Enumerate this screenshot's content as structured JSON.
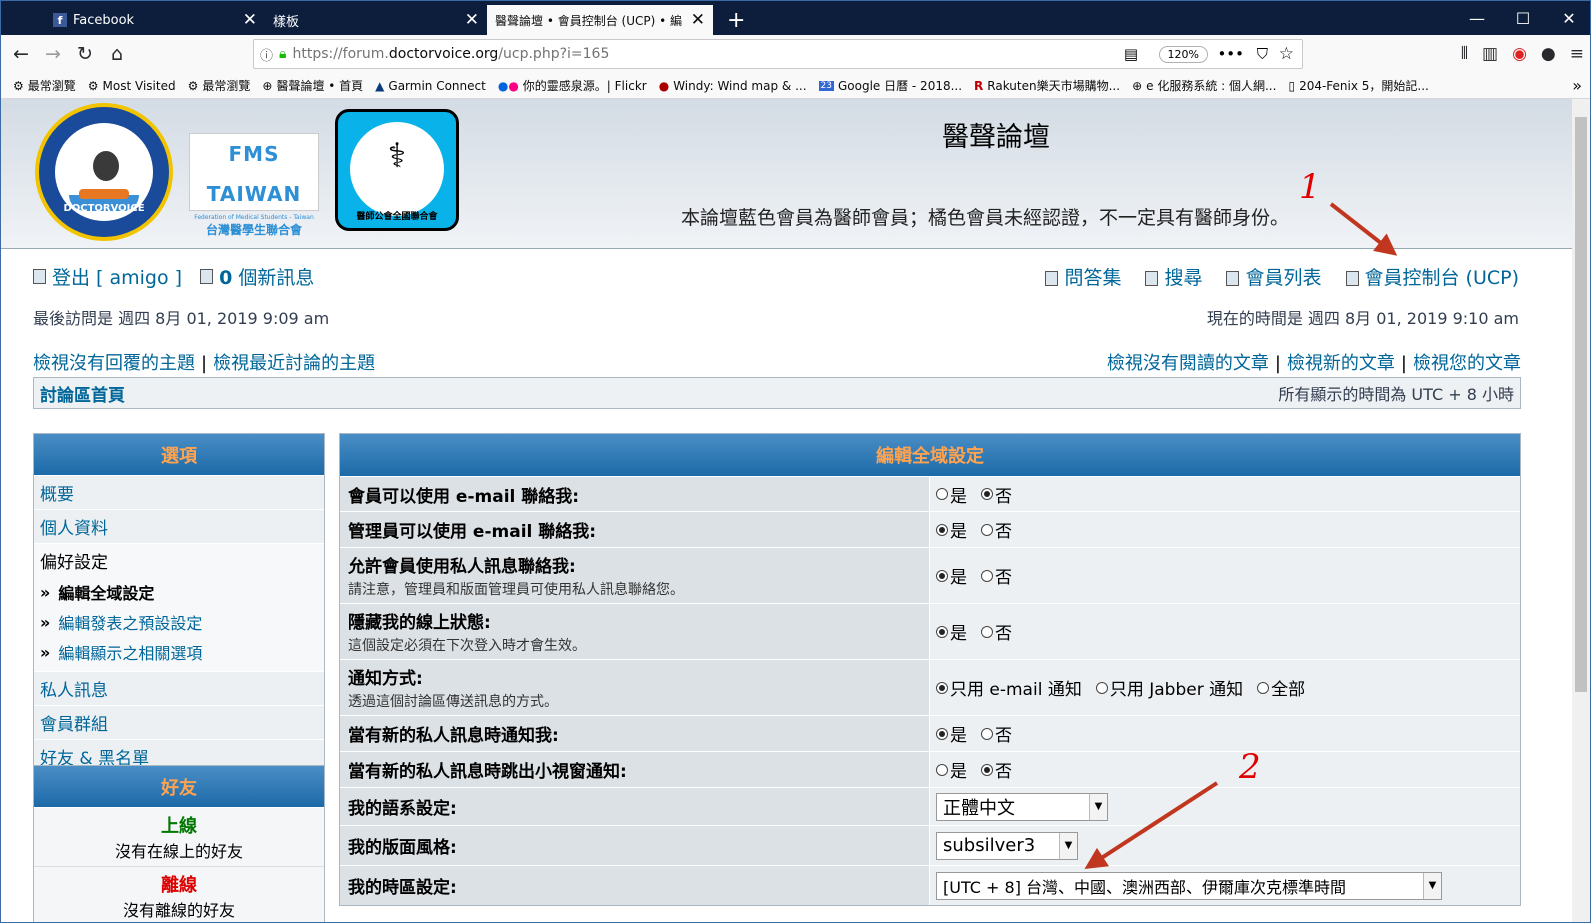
{
  "browser": {
    "tabs": [
      {
        "label": "Facebook"
      },
      {
        "label": "樣板"
      },
      {
        "label": "醫聲論壇 • 會員控制台 (UCP) • 編"
      }
    ],
    "url": {
      "prefix": "https://forum.",
      "host": "doctorvoice.org",
      "path": "/ucp.php?i=165"
    },
    "zoom": "120%",
    "bookmarks": [
      {
        "label": "最常瀏覽",
        "icon": "gear-icon"
      },
      {
        "label": "Most Visited",
        "icon": "gear-icon"
      },
      {
        "label": "最常瀏覽",
        "icon": "gear-icon"
      },
      {
        "label": "醫聲論壇 • 首頁",
        "icon": "globe-icon"
      },
      {
        "label": "Garmin Connect",
        "icon": "garmin-icon"
      },
      {
        "label": "你的靈感泉源。| Flickr",
        "icon": "flickr-icon"
      },
      {
        "label": "Windy: Wind map & ...",
        "icon": "windy-icon"
      },
      {
        "label": "Google 日曆 - 2018...",
        "icon": "calendar-icon"
      },
      {
        "label": "Rakuten樂天市場購物...",
        "icon": "rakuten-icon"
      },
      {
        "label": "e 化服務系統 : 個人網...",
        "icon": "globe-icon"
      },
      {
        "label": "204-Fenix 5，開始記...",
        "icon": "doc-icon"
      }
    ]
  },
  "site": {
    "title": "醫聲論壇",
    "description": "本論壇藍色會員為醫師會員；橘色會員未經認證，不一定具有醫師身份。",
    "logo1_text": "DOCTORVOICE",
    "logo2_main": "FMS TAIWAN",
    "logo2_sub": "Federation of Medical Students - Taiwan",
    "logo2_zh": "台灣醫學生聯合會",
    "logo3_zh": "醫師公會全國聯合會"
  },
  "annotations": {
    "one": "1",
    "two": "2"
  },
  "user": {
    "logout": "登出 [ amigo ]",
    "new_msgs_count": "0",
    "new_msgs_label": "個新訊息",
    "last_visit": "最後訪問是 週四 8月 01, 2019 9:09 am",
    "now": "現在的時間是 週四 8月 01, 2019 9:10 am"
  },
  "toplinks": {
    "faq": "問答集",
    "search": "搜尋",
    "members": "會員列表",
    "ucp": "會員控制台 (UCP)"
  },
  "searchlinks": {
    "unanswered": "檢視沒有回覆的主題",
    "active": "檢視最近討論的主題",
    "unread": "檢視沒有閱讀的文章",
    "newposts": "檢視新的文章",
    "egosearch": "檢視您的文章"
  },
  "navbar": {
    "home": "討論區首頁",
    "timezone": "所有顯示的時間為 UTC + 8 小時"
  },
  "options_panel": {
    "title": "選項",
    "overview": "概要",
    "profile": "個人資料",
    "prefs": "偏好設定",
    "prefs_sub": [
      "編輯全域設定",
      "編輯發表之預設設定",
      "編輯顯示之相關選項"
    ],
    "pm": "私人訊息",
    "groups": "會員群組",
    "friends_foes": "好友 & 黑名單"
  },
  "friends_panel": {
    "title": "好友",
    "online": "上線",
    "online_none": "沒有在線上的好友",
    "offline": "離線",
    "offline_none": "沒有離線的好友"
  },
  "settings": {
    "title": "編輯全域設定",
    "yes": "是",
    "no": "否",
    "rows": [
      {
        "label": "會員可以使用 e-mail 聯絡我:",
        "explain": ""
      },
      {
        "label": "管理員可以使用 e-mail 聯絡我:",
        "explain": ""
      },
      {
        "label": "允許會員使用私人訊息聯絡我:",
        "explain": "請注意，管理員和版面管理員可使用私人訊息聯絡您。"
      },
      {
        "label": "隱藏我的線上狀態:",
        "explain": "這個設定必須在下次登入時才會生效。"
      },
      {
        "label": "通知方式:",
        "explain": "透過這個討論區傳送訊息的方式。"
      },
      {
        "label": "當有新的私人訊息時通知我:",
        "explain": ""
      },
      {
        "label": "當有新的私人訊息時跳出小視窗通知:",
        "explain": ""
      },
      {
        "label": "我的語系設定:",
        "explain": ""
      },
      {
        "label": "我的版面風格:",
        "explain": ""
      },
      {
        "label": "我的時區設定:",
        "explain": ""
      }
    ],
    "notify_opts": [
      "只用 e-mail 通知",
      "只用 Jabber 通知",
      "全部"
    ],
    "language_value": "正體中文",
    "style_value": "subsilver3",
    "timezone_value": "[UTC + 8] 台灣、中國、澳洲西部、伊爾庫次克標準時間"
  }
}
